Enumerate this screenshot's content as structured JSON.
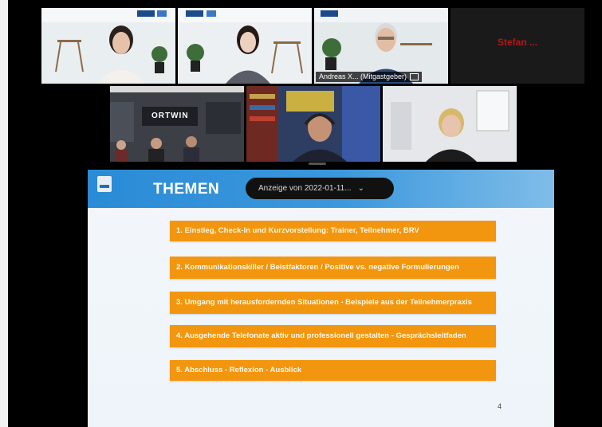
{
  "participants": [
    {
      "id": "p1",
      "name": "",
      "speaking": false
    },
    {
      "id": "p2",
      "name": "",
      "speaking": false
    },
    {
      "id": "p3",
      "name": "Andreas X...  (Mitgastgeber)",
      "speaking": true
    },
    {
      "id": "p4",
      "name": "",
      "speaking": false,
      "video_off_label": "Stefan ..."
    },
    {
      "id": "p5",
      "name": "",
      "speaking": false,
      "room_sign": "ORTWIN"
    },
    {
      "id": "p6",
      "name": "",
      "speaking": false
    },
    {
      "id": "p7",
      "name": "",
      "speaking": false
    }
  ],
  "share": {
    "viewing_label": "Anzeige von 2022-01-11...",
    "dropdown_icon": "chevron-down-icon"
  },
  "slide": {
    "title": "THEMEN",
    "items": [
      "1. Einstieg, Check-In und Kurzvorstellung: Trainer, Teilnehmer, BRV",
      "2. Kommunikationskiller / Beistfaktoren / Positive vs. negative Formulierungen",
      "3. Umgang mit herausfordernden Situationen - Beispiele aus der Teilnehmerpraxis",
      "4. Ausgehende Telefonate aktiv und professionell gestalten - Gesprächsleitfaden",
      "5. Abschluss - Reflexion - Ausblick"
    ],
    "page_number": "4"
  },
  "colors": {
    "accent": "#33b6ff",
    "agenda_orange": "#f3960f",
    "header_blue": "#2a8bd6",
    "video_off_name": "#b01818"
  }
}
